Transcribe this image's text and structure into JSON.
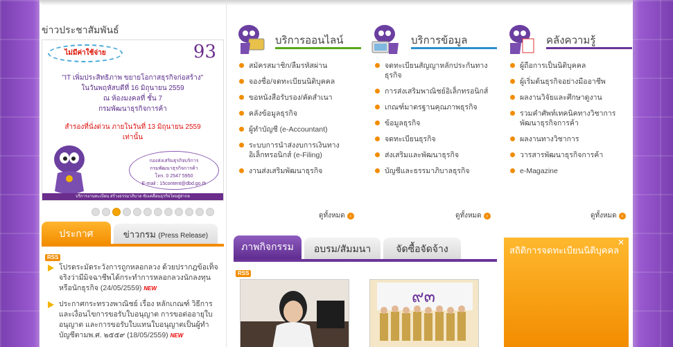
{
  "news": {
    "title": "ข่าวประชาสัมพันธ์",
    "banner": {
      "badge": "ไม่มีค่าใช้จ่าย",
      "logo": "93",
      "text_lines": [
        "\"IT เพิ่มประสิทธิภาพ ขยายโอกาสธุรกิจก่อสร้าง\"",
        "ในวันพฤหัสบดีที่ 16 มิถุนายน 2559",
        "ณ ห้องมงคลที่ ชั้น 7",
        "กรมพัฒนาธุรกิจการค้า"
      ],
      "red_lines": [
        "สำรองที่นั่งด่วน ภายในวันที่ 13 มิถุนายน 2559",
        "เท่านั้น"
      ],
      "contact_lines": [
        "กองส่งเสริมธุรกิจบริการ",
        "กรมพัฒนาธุรกิจการค้า",
        "โทร. 0 2547 5950",
        "E-mail : 15content@dbd.go.th"
      ],
      "footer": "บริการงานทะเบียน สร้างธรรมาภิบาล ขับเคลื่อนธุรกิจไทยสู่สากล"
    },
    "slide_count": 12,
    "active_slide": 3
  },
  "left_tabs": {
    "announcement": "ประกาศ",
    "press_main": "ข่าวกรม",
    "press_sub": "(Press Release)"
  },
  "rss_label": "RSS",
  "new_label": "NEW",
  "announcements": [
    {
      "text": "โปรดระมัดระวังการถูกหลอกลวง ด้วยปรากฎข้อเท็จจริงว่ามีมิจฉาชีพได้กระทำการหลอกลวงนักลงทุนหรือนักธุรกิจ (24/05/2559)",
      "is_new": true
    },
    {
      "text": "ประกาศกระทรวงพาณิชย์ เรื่อง หลักเกณฑ์ วิธีการ และเงื่อนไขการขอรับใบอนุญาต การขอต่ออายุใบอนุญาต และการขอรับใบแทนใบอนุญาตเป็นผู้ทำบัญชีตามพ.ศ. ๒๕๕๙ (18/05/2559)",
      "is_new": true
    }
  ],
  "services": [
    {
      "title": "บริการออนไลน์",
      "accent": "#58a618",
      "items": [
        "สมัครสมาชิก/ลืมรหัสผ่าน",
        "จองชื่อ/จดทะเบียนนิติบุคคล",
        "ขอหนังสือรับรอง/คัดสำเนา",
        "คลังข้อมูลธุรกิจ",
        "ผู้ทำบัญชี (e-Accountant)",
        "ระบบการนำส่งงบการเงินทางอิเล็กทรอนิกส์ (e-Filing)",
        "งานส่งเสริมพัฒนาธุรกิจ"
      ],
      "more": "ดูทั้งหมด"
    },
    {
      "title": "บริการข้อมูล",
      "accent": "#2a8fcf",
      "items": [
        "จดทะเบียนสัญญาหลักประกันทางธุรกิจ",
        "การส่งเสริมพาณิชย์อิเล็กทรอนิกส์",
        "เกณฑ์มาตรฐานคุณภาพธุรกิจ",
        "ข้อมูลธุรกิจ",
        "จดทะเบียนธุรกิจ",
        "ส่งเสริมและพัฒนาธุรกิจ",
        "บัญชีและธรรมาภิบาลธุรกิจ"
      ],
      "more": "ดูทั้งหมด"
    },
    {
      "title": "คลังความรู้",
      "accent": "#6b3499",
      "items": [
        "ผู้ถือการเป็นนิติบุคคล",
        "ผู้เริ่มต้นธุรกิจอย่างมืออาชีพ",
        "ผลงานวิจัยและศึกษาดูงาน",
        "รวมคำศัพท์เทคนิคทางวิชาการพัฒนาธุรกิจการค้า",
        "ผลงานทางวิชาการ",
        "วารสารพัฒนาธุรกิจการค้า",
        "e-Magazine"
      ],
      "more": "ดูทั้งหมด"
    }
  ],
  "activity_tabs": [
    "ภาพกิจกรรม",
    "อบรม/สัมมนา",
    "จัดซื้อจัดจ้าง"
  ],
  "stats": {
    "title": "สถิติการจดทะเบียนนิติบุคคล",
    "close": "✕"
  }
}
